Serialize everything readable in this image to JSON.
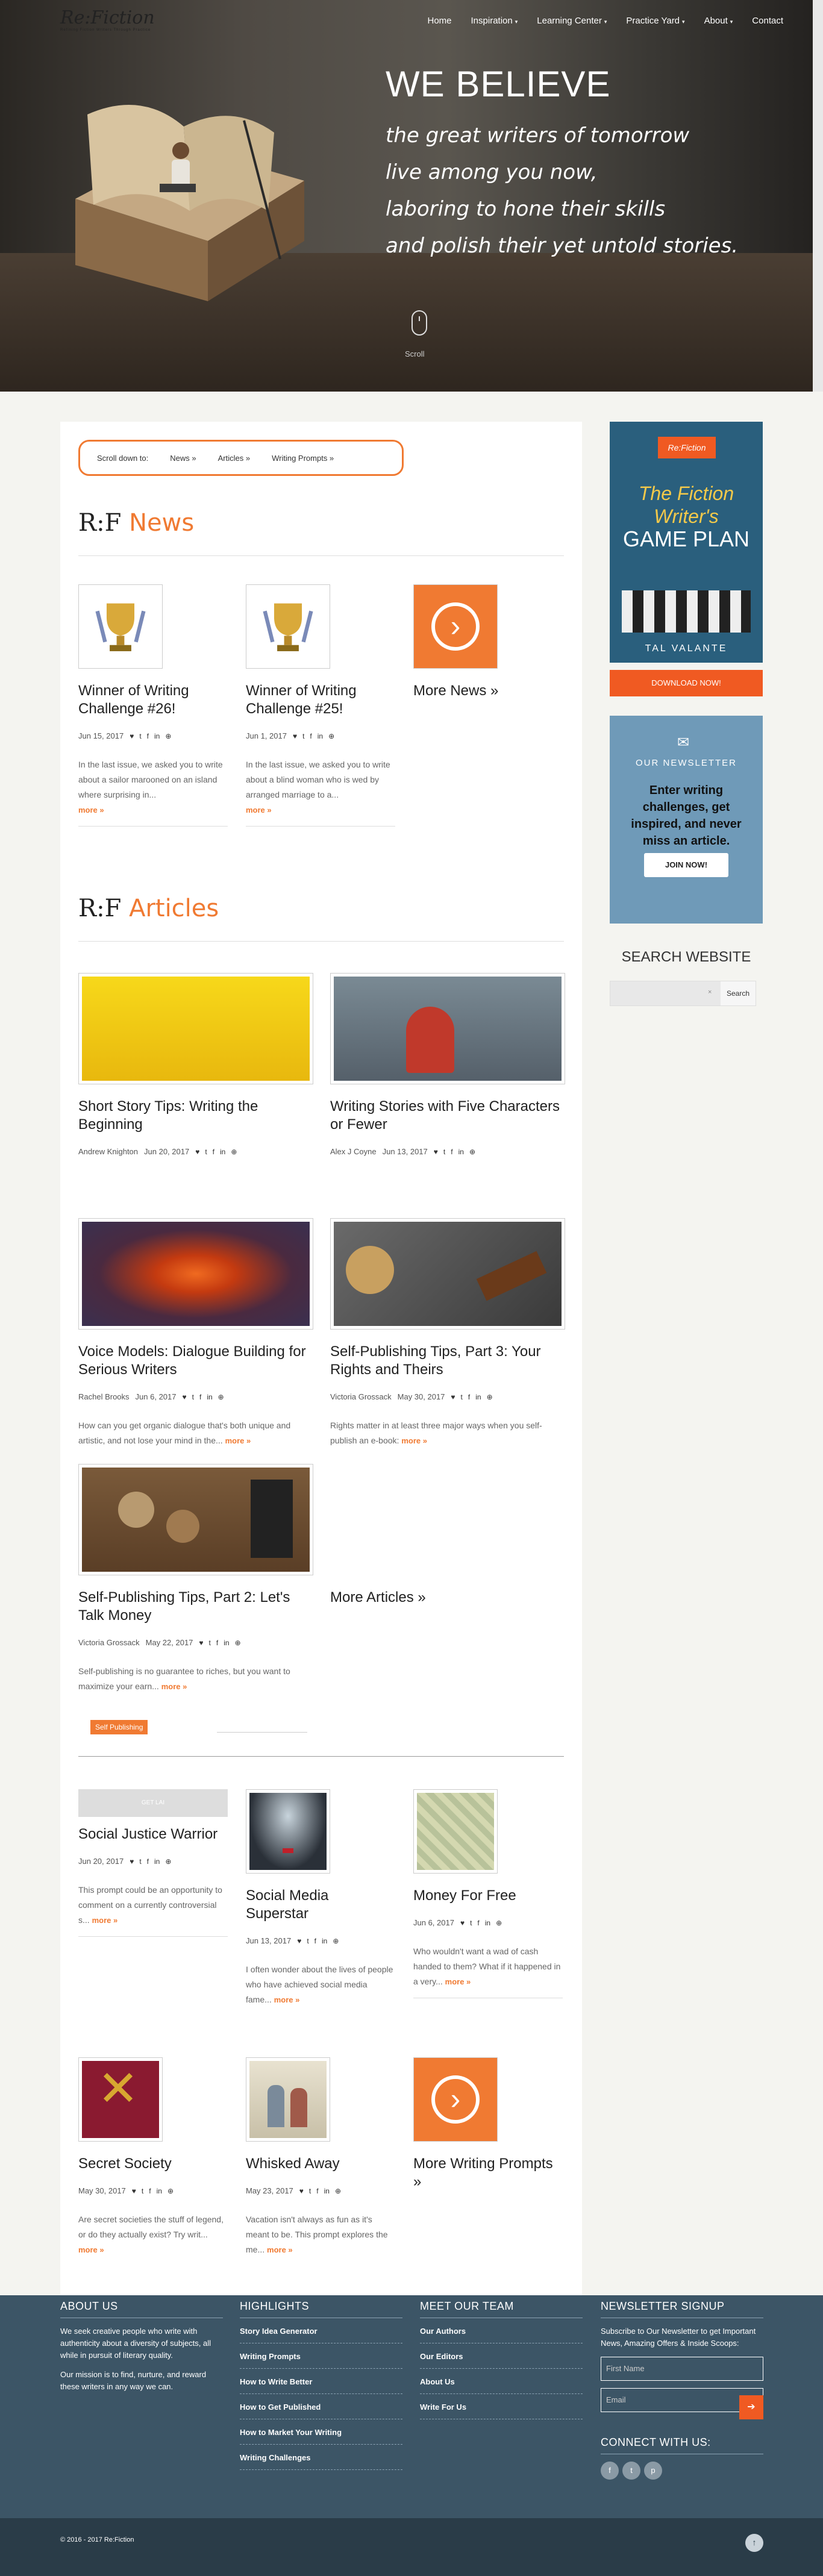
{
  "brand": {
    "logo": "Re:Fiction",
    "tagline": "Refining Fiction Writers Through Practice"
  },
  "nav": [
    {
      "label": "Home",
      "dropdown": false
    },
    {
      "label": "Inspiration",
      "dropdown": true
    },
    {
      "label": "Learning Center",
      "dropdown": true
    },
    {
      "label": "Practice Yard",
      "dropdown": true
    },
    {
      "label": "About",
      "dropdown": true
    },
    {
      "label": "Contact",
      "dropdown": false
    }
  ],
  "hero": {
    "headline": "WE BELIEVE",
    "lines": [
      "the great writers of tomorrow",
      "live among you now,",
      "laboring to hone their skills",
      "and polish their yet untold stories."
    ],
    "scroll_label": "Scroll"
  },
  "scrollbox": {
    "label": "Scroll down to:",
    "links": [
      "News »",
      "Articles »",
      "Writing Prompts »"
    ]
  },
  "news": {
    "title_rf": "R:F",
    "title": "News",
    "items": [
      {
        "title": "Winner of Writing Challenge #26!",
        "date": "Jun 15, 2017",
        "excerpt": "In the last issue, we asked you to write about a sailor marooned on an island where surprising in...",
        "more": "more »"
      },
      {
        "title": "Winner of Writing Challenge #25!",
        "date": "Jun 1, 2017",
        "excerpt": "In the last issue, we asked you to write about a blind woman who is wed by arranged marriage to a...",
        "more": "more »"
      }
    ],
    "more_link": "More News »"
  },
  "articles": {
    "title_rf": "R:F",
    "title": "Articles",
    "items": [
      {
        "title": "Short Story Tips: Writing the Beginning",
        "author": "Andrew Knighton",
        "date": "Jun 20, 2017",
        "excerpt": "",
        "more": ""
      },
      {
        "title": "Writing Stories with Five Characters or Fewer",
        "author": "Alex J Coyne",
        "date": "Jun 13, 2017",
        "excerpt": "",
        "more": ""
      },
      {
        "title": "Voice Models: Dialogue Building for Serious Writers",
        "author": "Rachel Brooks",
        "date": "Jun 6, 2017",
        "excerpt": "How can you get organic dialogue that's both unique and artistic, and not lose your mind in the...",
        "more": "more »"
      },
      {
        "title": "Self-Publishing Tips, Part 3: Your Rights and Theirs",
        "author": "Victoria Grossack",
        "date": "May 30, 2017",
        "excerpt": "Rights matter in at least three major ways when you self-publish an e-book:",
        "more": "more »"
      },
      {
        "title": "Self-Publishing Tips, Part 2: Let's Talk Money",
        "author": "Victoria Grossack",
        "date": "May 22, 2017",
        "excerpt": "Self-publishing is no guarantee to riches, but you want to maximize your earn...",
        "more": "more »",
        "tag": "Self Publishing"
      }
    ],
    "more_link": "More Articles »"
  },
  "prompts": [
    {
      "title": "Social Justice Warrior",
      "date": "Jun 20, 2017",
      "excerpt": "This prompt could be an opportunity to comment on a currently controversial s...",
      "more": "more »",
      "img_label": "GET LAI"
    },
    {
      "title": "Social Media Superstar",
      "date": "Jun 13, 2017",
      "excerpt": "I often wonder about the lives of people who have achieved social media fame...",
      "more": "more »"
    },
    {
      "title": "Money For Free",
      "date": "Jun 6, 2017",
      "excerpt": "Who wouldn't want a wad of cash handed to them? What if it happened in a very...",
      "more": "more »"
    },
    {
      "title": "Secret Society",
      "date": "May 30, 2017",
      "excerpt": "Are secret societies the stuff of legend, or do they actually exist? Try writ...",
      "more": "more »"
    },
    {
      "title": "Whisked Away",
      "date": "May 23, 2017",
      "excerpt": "Vacation isn't always as fun as it's meant to be. This prompt explores the me...",
      "more": "more »"
    }
  ],
  "prompts_more": "More Writing Prompts »",
  "social_icons": [
    "♥",
    "t",
    "f",
    "in",
    "⊕"
  ],
  "sidebar": {
    "ebook": {
      "brand": "Re:Fiction",
      "title_lines": [
        "The Fiction",
        "Writer's",
        "GAME PLAN"
      ],
      "author": "TAL VALANTE"
    },
    "download_btn": "DOWNLOAD NOW!",
    "newsletter": {
      "title": "OUR NEWSLETTER",
      "text": "Enter writing challenges, get inspired, and never miss an article.",
      "button": "JOIN NOW!"
    },
    "search": {
      "title": "SEARCH WEBSITE",
      "button": "Search",
      "placeholder": ""
    }
  },
  "footer": {
    "about": {
      "head": "ABOUT US",
      "text1": "We seek creative people who write with authenticity about a diversity of subjects, all while in pursuit of literary quality.",
      "text2": "Our mission is to find, nurture, and reward these writers in any way we can."
    },
    "highlights": {
      "head": "HIGHLIGHTS",
      "links": [
        "Story Idea Generator",
        "Writing Prompts",
        "How to Write Better",
        "How to Get Published",
        "How to Market Your Writing",
        "Writing Challenges"
      ]
    },
    "team": {
      "head": "MEET OUR TEAM",
      "links": [
        "Our Authors",
        "Our Editors",
        "About Us",
        "Write For Us"
      ]
    },
    "signup": {
      "head": "NEWSLETTER SIGNUP",
      "text": "Subscribe to Our Newsletter to get Important News, Amazing Offers & Inside Scoops:",
      "name_ph": "First Name",
      "email_ph": "Email",
      "connect": "CONNECT WITH US:"
    },
    "copyright": "© 2016 - 2017 Re:Fiction"
  },
  "colors": {
    "accent": "#f07a32",
    "footer": "#3c5566",
    "footer_bottom": "#2a3c48"
  }
}
